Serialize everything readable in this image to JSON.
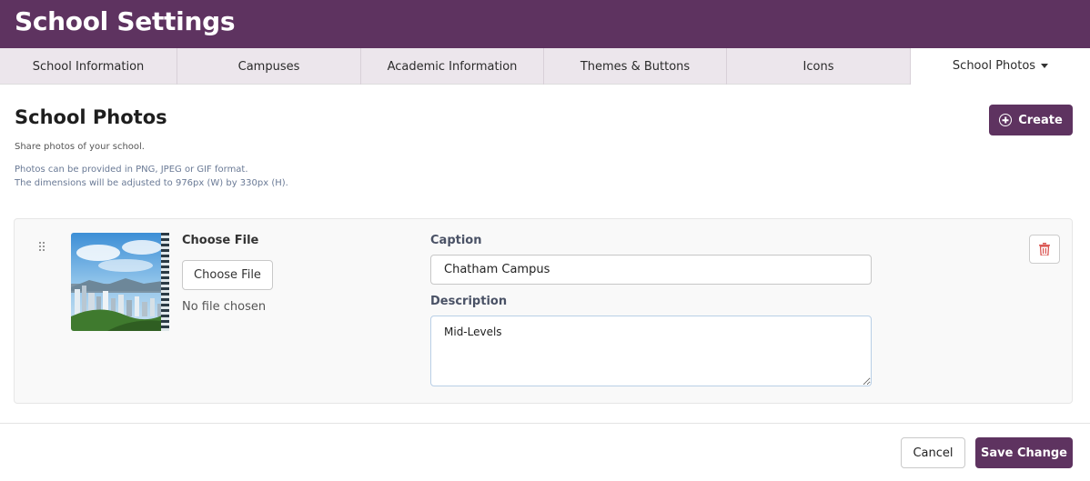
{
  "header": {
    "title": "School Settings",
    "color": "#5e3360"
  },
  "tabs": [
    {
      "label": "School Information",
      "active": false
    },
    {
      "label": "Campuses",
      "active": false
    },
    {
      "label": "Academic Information",
      "active": false
    },
    {
      "label": "Themes & Buttons",
      "active": false
    },
    {
      "label": "Icons",
      "active": false
    },
    {
      "label": "School Photos",
      "active": true,
      "has_dropdown": true
    }
  ],
  "page": {
    "title": "School Photos",
    "subtitle": "Share photos of your school.",
    "info_line1": "Photos can be provided in PNG, JPEG or GIF format.",
    "info_line2": "The dimensions will be adjusted to 976px (W) by 330px (H).",
    "create_label": "Create",
    "create_icon": "plus-circle-icon"
  },
  "photos": [
    {
      "file_label": "Choose File",
      "file_button": "Choose File",
      "file_status": "No file chosen",
      "caption_label": "Caption",
      "caption_value": "Chatham Campus",
      "description_label": "Description",
      "description_value": "Mid-Levels",
      "delete_icon": "trash-icon",
      "drag_icon": "drag-handle-icon",
      "thumbnail": "city-skyline-photo"
    }
  ],
  "footer": {
    "cancel_label": "Cancel",
    "save_label": "Save Change"
  },
  "colors": {
    "accent": "#5e3360",
    "delete": "#d9534f",
    "tab_bar": "#ece6ec"
  }
}
